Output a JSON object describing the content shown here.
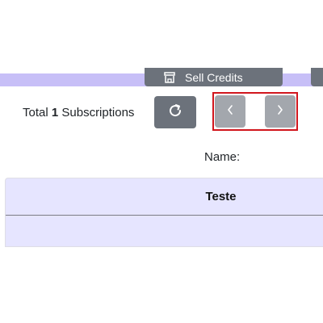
{
  "header": {
    "sell_credits_label": "Sell Credits",
    "sell_credits_icon": "store-icon"
  },
  "summary": {
    "total_prefix": "Total",
    "total_count": "1",
    "total_suffix": "Subscriptions"
  },
  "controls": {
    "refresh_icon": "refresh-icon",
    "prev_icon": "chevron-left-icon",
    "next_icon": "chevron-right-icon"
  },
  "filter": {
    "name_label": "Name:"
  },
  "table": {
    "columns": [
      "Teste"
    ]
  },
  "colors": {
    "accent_bar": "#c7bff7",
    "button_dark": "#6c727b",
    "button_light": "#a3a7ad",
    "highlight": "#d1161d",
    "table_bg": "#e6e5ff"
  }
}
